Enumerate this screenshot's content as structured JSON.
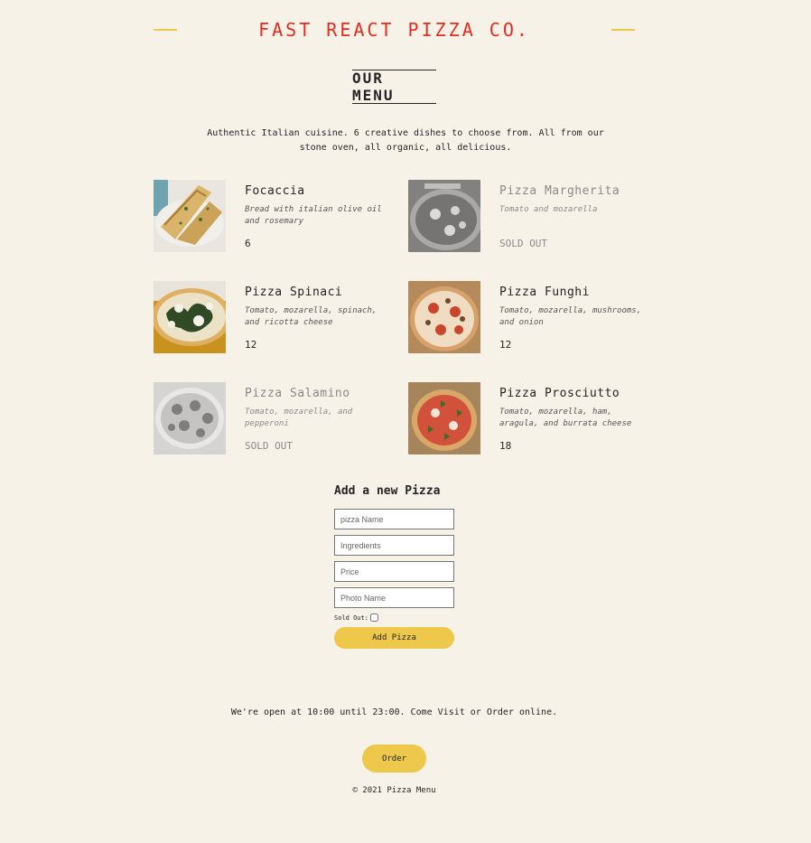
{
  "header": {
    "title": "FAST REACT PIZZA CO."
  },
  "menu": {
    "heading": "OUR MENU",
    "intro": "Authentic Italian cuisine. 6 creative dishes to choose from. All from our stone oven, all organic, all delicious.",
    "pizzas": [
      {
        "name": "Focaccia",
        "ingredients": "Bread with italian olive oil and rosemary",
        "price": "6",
        "sold_out": false
      },
      {
        "name": "Pizza Margherita",
        "ingredients": "Tomato and mozarella",
        "price": "SOLD OUT",
        "sold_out": true
      },
      {
        "name": "Pizza Spinaci",
        "ingredients": "Tomato, mozarella, spinach, and ricotta cheese",
        "price": "12",
        "sold_out": false
      },
      {
        "name": "Pizza Funghi",
        "ingredients": "Tomato, mozarella, mushrooms, and onion",
        "price": "12",
        "sold_out": false
      },
      {
        "name": "Pizza Salamino",
        "ingredients": "Tomato, mozarella, and pepperoni",
        "price": "SOLD OUT",
        "sold_out": true
      },
      {
        "name": "Pizza Prosciutto",
        "ingredients": "Tomato, mozarella, ham, aragula, and burrata cheese",
        "price": "18",
        "sold_out": false
      }
    ]
  },
  "form": {
    "heading": "Add a new Pizza",
    "name_placeholder": "pizza Name",
    "ingredients_placeholder": "Ingredients",
    "price_placeholder": "Price",
    "photo_placeholder": "Photo Name",
    "sold_out_label": "Sold Out:",
    "submit_label": "Add Pizza"
  },
  "footer": {
    "hours": "We're open at 10:00 until 23:00. Come Visit or Order online.",
    "order_label": "Order",
    "copyright": "© 2021 Pizza Menu"
  },
  "colors": {
    "background": "#f7f2e8",
    "accent": "#edc84b",
    "brand": "#e52a1f"
  }
}
